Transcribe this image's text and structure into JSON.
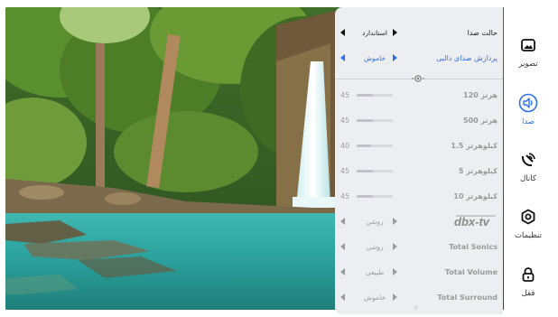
{
  "sidebar": {
    "items": [
      {
        "label": "تصویر",
        "icon": "picture-icon",
        "active": false
      },
      {
        "label": "صدا",
        "icon": "speaker-icon",
        "active": true
      },
      {
        "label": "کانال",
        "icon": "satellite-dish-icon",
        "active": false
      },
      {
        "label": "تنظیمات",
        "icon": "settings-gear-icon",
        "active": false
      },
      {
        "label": "قفل",
        "icon": "lock-icon",
        "active": false
      }
    ]
  },
  "audio": {
    "sound_mode": {
      "label": "حالت صدا",
      "value": "استاندارد"
    },
    "dali": {
      "label": "پردازش صدای دالبی",
      "value": "خاموش"
    },
    "equalizer": [
      {
        "band": "120 هرتز",
        "value": "45",
        "level": 45
      },
      {
        "band": "500 هرتز",
        "value": "45",
        "level": 45
      },
      {
        "band": "1.5 کیلوهرتز",
        "value": "40",
        "level": 40
      },
      {
        "band": "5 کیلوهرتز",
        "value": "45",
        "level": 45
      },
      {
        "band": "10 کیلوهرتز",
        "value": "45",
        "level": 45
      }
    ],
    "dbx": {
      "logo": "dbx-tv",
      "value": "روشن"
    },
    "total_sonics": {
      "label": "Total Sonics",
      "value": "روشن"
    },
    "total_volume": {
      "label": "Total Volume",
      "value": "طبیعی"
    },
    "total_surround": {
      "label": "Total Surround",
      "value": "خاموش"
    }
  },
  "colors": {
    "accent": "#2b6ef0",
    "panel_bg": "#eceef1",
    "dim_text": "#9a9a9a"
  }
}
